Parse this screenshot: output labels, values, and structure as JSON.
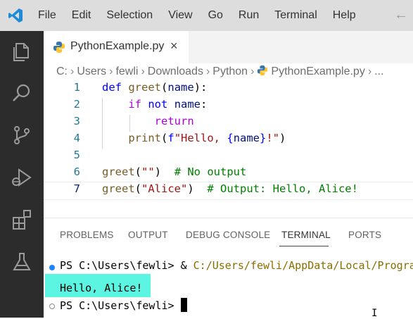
{
  "menu": [
    "File",
    "Edit",
    "Selection",
    "View",
    "Go",
    "Run",
    "Terminal",
    "Help"
  ],
  "tab": {
    "filename": "PythonExample.py",
    "close_symbol": "×"
  },
  "breadcrumb": [
    "C:",
    "Users",
    "fewli",
    "Downloads",
    "Python",
    "PythonExample.py",
    "..."
  ],
  "code_lines": [
    {
      "number": "1",
      "code": "def greet(name):"
    },
    {
      "number": "2",
      "code": "    if not name:"
    },
    {
      "number": "3",
      "code": "        return"
    },
    {
      "number": "4",
      "code": "    print(f\"Hello, {name}!\")"
    },
    {
      "number": "5",
      "code": ""
    },
    {
      "number": "6",
      "code": "greet(\"\")  # No output"
    },
    {
      "number": "7",
      "code": "greet(\"Alice\")  # Output: Hello, Alice!"
    }
  ],
  "panel_tabs": [
    "PROBLEMS",
    "OUTPUT",
    "DEBUG CONSOLE",
    "TERMINAL",
    "PORTS"
  ],
  "active_panel_tab": "TERMINAL",
  "terminal": {
    "prompt": "PS C:\\Users\\fewli>",
    "command_prefix": "&",
    "command_path": "C:/Users/fewli/AppData/Local/Progra",
    "output": "Hello, Alice!"
  },
  "colors": {
    "keyword": "#0000ff",
    "control_keyword": "#af00db",
    "function": "#795e26",
    "string": "#a31515",
    "comment": "#008000",
    "line_number": "#237893",
    "terminal_highlight": "#5cf5e2"
  },
  "icons": [
    "vscode-logo-icon",
    "back-arrow-icon",
    "explorer-icon",
    "search-icon",
    "source-control-icon",
    "run-debug-icon",
    "extensions-icon",
    "testing-icon",
    "python-file-icon"
  ]
}
